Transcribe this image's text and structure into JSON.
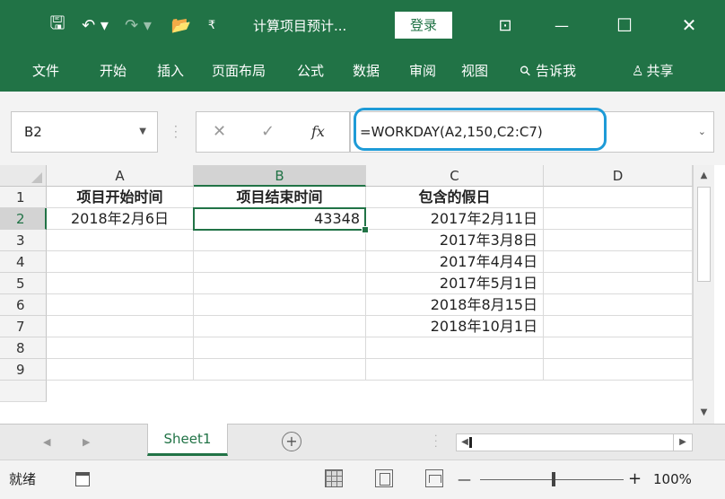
{
  "titlebar": {
    "doc_title": "计算项目预计...",
    "login_label": "登录",
    "save_glyph": "🖫",
    "undo_glyph": "↶ ▾",
    "redo_glyph": "↷ ▾",
    "open_glyph": "📂",
    "more_glyph": "₹",
    "ribbon_display_glyph": "⊡",
    "minimize_glyph": "—",
    "maximize_glyph": "☐",
    "close_glyph": "✕",
    "background_color": "#217346"
  },
  "ribbon": {
    "tabs": [
      "文件",
      "开始",
      "插入",
      "页面布局",
      "公式",
      "数据",
      "审阅",
      "视图"
    ],
    "tell_me": "告诉我",
    "tell_me_icon": "⚲",
    "share": "共享",
    "share_icon": "♙"
  },
  "formula_bar": {
    "name_box": "B2",
    "cancel_glyph": "✕",
    "enter_glyph": "✓",
    "fx_label": "fx",
    "formula": "=WORKDAY(A2,150,C2:C7)",
    "highlight_color": "#1e9bd7"
  },
  "grid": {
    "columns": [
      "A",
      "B",
      "C",
      "D"
    ],
    "selected_column": "B",
    "rows": [
      "1",
      "2",
      "3",
      "4",
      "5",
      "6",
      "7",
      "8",
      "9"
    ],
    "selected_row": "2",
    "headers": {
      "A1": "项目开始时间",
      "B1": "项目结束时间",
      "C1": "包含的假日"
    },
    "A2": "2018年2月6日",
    "B2": "43348",
    "holidays": [
      "2017年2月11日",
      "2017年3月8日",
      "2017年4月4日",
      "2017年5月1日",
      "2018年8月15日",
      "2018年10月1日"
    ],
    "active_cell": "B2"
  },
  "sheet_tabs": {
    "sheets": [
      "Sheet1"
    ],
    "active": "Sheet1",
    "add_label": "+"
  },
  "statusbar": {
    "ready": "就绪",
    "zoom_minus": "—",
    "zoom_plus": "+",
    "zoom": "100%"
  },
  "colors": {
    "accent": "#217346"
  }
}
